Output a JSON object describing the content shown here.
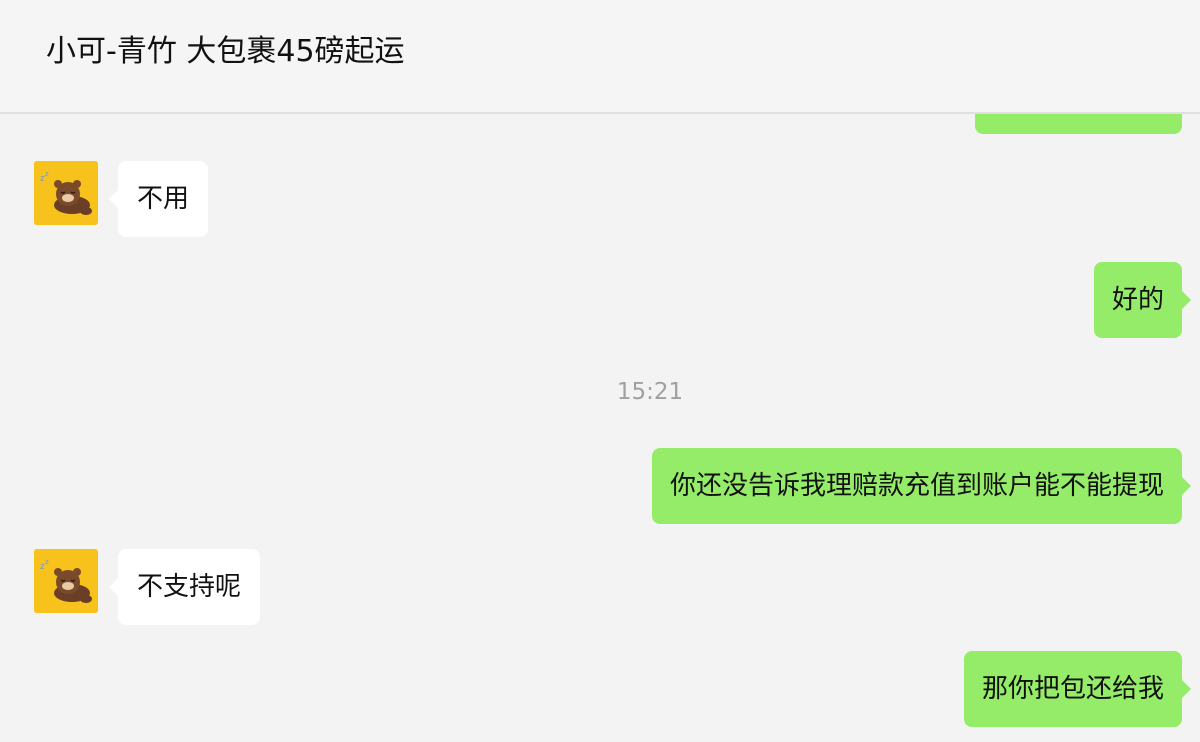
{
  "header": {
    "title": "小可-青竹 大包裹45磅起运"
  },
  "messages": [
    {
      "direction": "in",
      "text": "不用"
    },
    {
      "direction": "out",
      "text": "好的"
    },
    {
      "direction": "out",
      "text": "你还没告诉我理赔款充值到账户能不能提现"
    },
    {
      "direction": "in",
      "text": "不支持呢"
    },
    {
      "direction": "out",
      "text": "那你把包还给我"
    }
  ],
  "timestamp": "15:21",
  "icons": {
    "contact_avatar": "brown-bear-sleeping-icon"
  },
  "colors": {
    "incoming_bubble": "#ffffff",
    "outgoing_bubble": "#95ec69",
    "background": "#f3f3f3",
    "avatar_bg": "#f7c21b"
  }
}
